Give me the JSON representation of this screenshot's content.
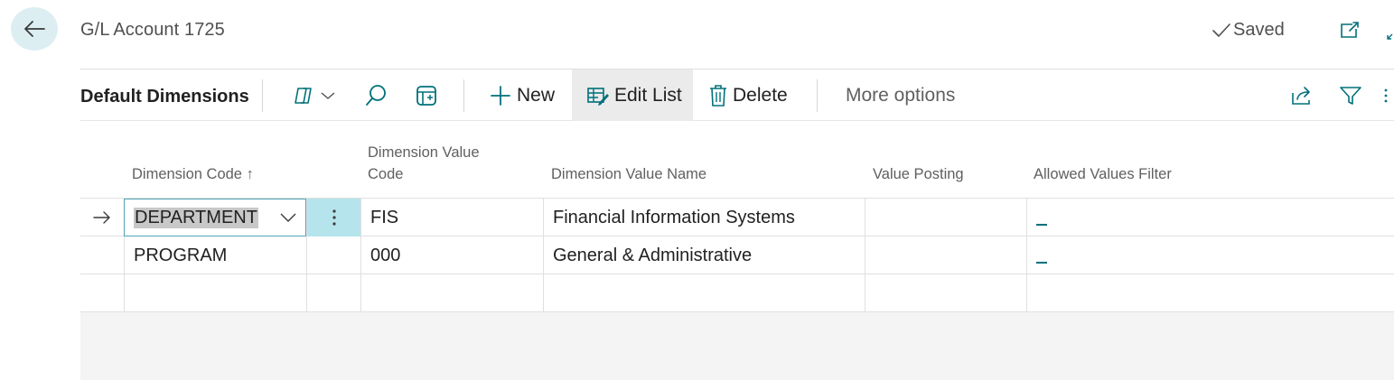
{
  "header": {
    "title": "G/L Account 1725",
    "saved_label": "Saved"
  },
  "actionbar": {
    "part_title": "Default Dimensions",
    "new_label": "New",
    "edit_list_label": "Edit List",
    "delete_label": "Delete",
    "more_options_label": "More options"
  },
  "table": {
    "columns": {
      "dimension_code": "Dimension Code",
      "dimension_value_code_line1": "Dimension Value",
      "dimension_value_code_line2": "Code",
      "dimension_value_name": "Dimension Value Name",
      "value_posting": "Value Posting",
      "allowed_values_filter": "Allowed Values Filter"
    },
    "sort_indicator": "↑",
    "rows": [
      {
        "dimension_code": "DEPARTMENT",
        "dimension_value_code": "FIS",
        "dimension_value_name": "Financial Information Systems",
        "value_posting": "",
        "allowed_values_filter": "_"
      },
      {
        "dimension_code": "PROGRAM",
        "dimension_value_code": "000",
        "dimension_value_name": "General & Administrative",
        "value_posting": "",
        "allowed_values_filter": "_"
      }
    ]
  },
  "colors": {
    "accent": "#00707a",
    "active_cell_bg": "#b5e4ec",
    "back_button_bg": "#dceef2"
  }
}
